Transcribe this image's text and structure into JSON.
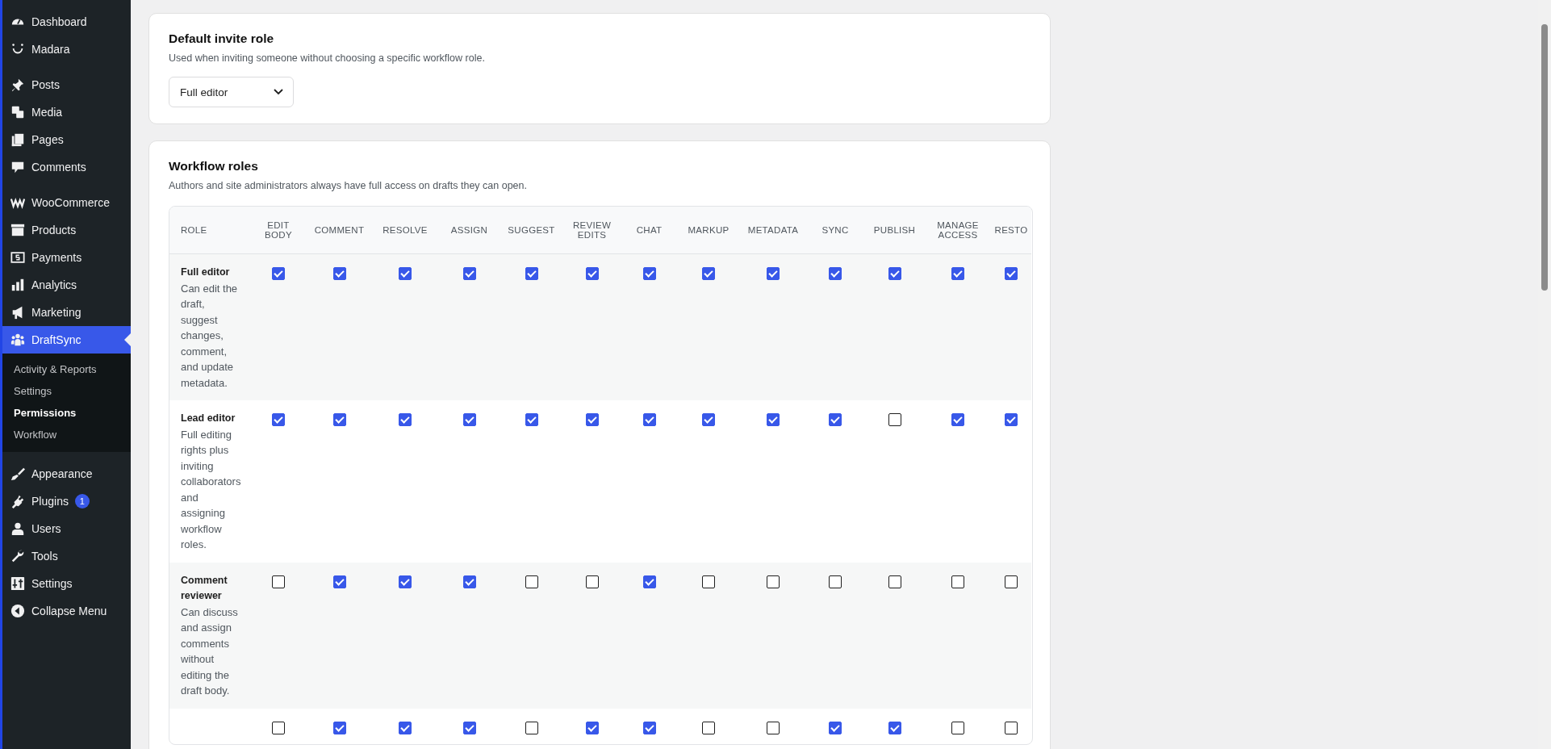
{
  "sidebar": {
    "groups": [
      {
        "items": [
          {
            "label": "Dashboard",
            "selected": false
          },
          {
            "label": "Madara",
            "selected": false
          }
        ]
      },
      {
        "items": [
          {
            "label": "Posts",
            "selected": false
          },
          {
            "label": "Media",
            "selected": false
          },
          {
            "label": "Pages",
            "selected": false
          },
          {
            "label": "Comments",
            "selected": false
          }
        ]
      },
      {
        "items": [
          {
            "label": "WooCommerce",
            "selected": false
          },
          {
            "label": "Products",
            "selected": false
          },
          {
            "label": "Payments",
            "selected": false
          },
          {
            "label": "Analytics",
            "selected": false
          },
          {
            "label": "Marketing",
            "selected": false
          },
          {
            "label": "DraftSync",
            "selected": true,
            "children": [
              {
                "label": "Activity & Reports",
                "selected": false
              },
              {
                "label": "Settings",
                "selected": false
              },
              {
                "label": "Permissions",
                "selected": true
              },
              {
                "label": "Workflow",
                "selected": false
              }
            ]
          }
        ]
      },
      {
        "items": [
          {
            "label": "Appearance",
            "selected": false
          },
          {
            "label": "Plugins",
            "selected": false,
            "badge": "1"
          },
          {
            "label": "Users",
            "selected": false
          },
          {
            "label": "Tools",
            "selected": false
          },
          {
            "label": "Settings",
            "selected": false
          },
          {
            "label": "Collapse Menu",
            "selected": false
          }
        ]
      }
    ]
  },
  "default_invite_role": {
    "title": "Default invite role",
    "description": "Used when inviting someone without choosing a specific workflow role.",
    "select": {
      "value": "Full editor"
    }
  },
  "workflow_roles": {
    "title": "Workflow roles",
    "description": "Authors and site administrators always have full access on drafts they can open.",
    "columns": [
      [
        "ROLE"
      ],
      [
        "EDIT",
        "BODY"
      ],
      [
        "COMMENT"
      ],
      [
        "RESOLVE"
      ],
      [
        "ASSIGN"
      ],
      [
        "SUGGEST"
      ],
      [
        "REVIEW",
        "EDITS"
      ],
      [
        "CHAT"
      ],
      [
        "MARKUP"
      ],
      [
        "METADATA"
      ],
      [
        "SYNC"
      ],
      [
        "PUBLISH"
      ],
      [
        "MANAGE",
        "ACCESS"
      ],
      [
        "RESTO"
      ]
    ],
    "rows": [
      {
        "name": "Full editor",
        "description": "Can edit the draft, suggest changes, comment, and update metadata.",
        "checks": [
          true,
          true,
          true,
          true,
          true,
          true,
          true,
          true,
          true,
          true,
          true,
          true,
          true
        ]
      },
      {
        "name": "Lead editor",
        "description": "Full editing rights plus inviting collaborators and assigning workflow roles.",
        "checks": [
          true,
          true,
          true,
          true,
          true,
          true,
          true,
          true,
          true,
          true,
          false,
          true,
          true
        ]
      },
      {
        "name": "Comment reviewer",
        "description": "Can discuss and assign comments without editing the draft body.",
        "checks": [
          false,
          true,
          true,
          true,
          false,
          false,
          true,
          false,
          false,
          false,
          false,
          false,
          false
        ]
      },
      {
        "checks": [
          false,
          true,
          true,
          true,
          false,
          true,
          true,
          false,
          false,
          true,
          true,
          false,
          false
        ]
      }
    ]
  }
}
